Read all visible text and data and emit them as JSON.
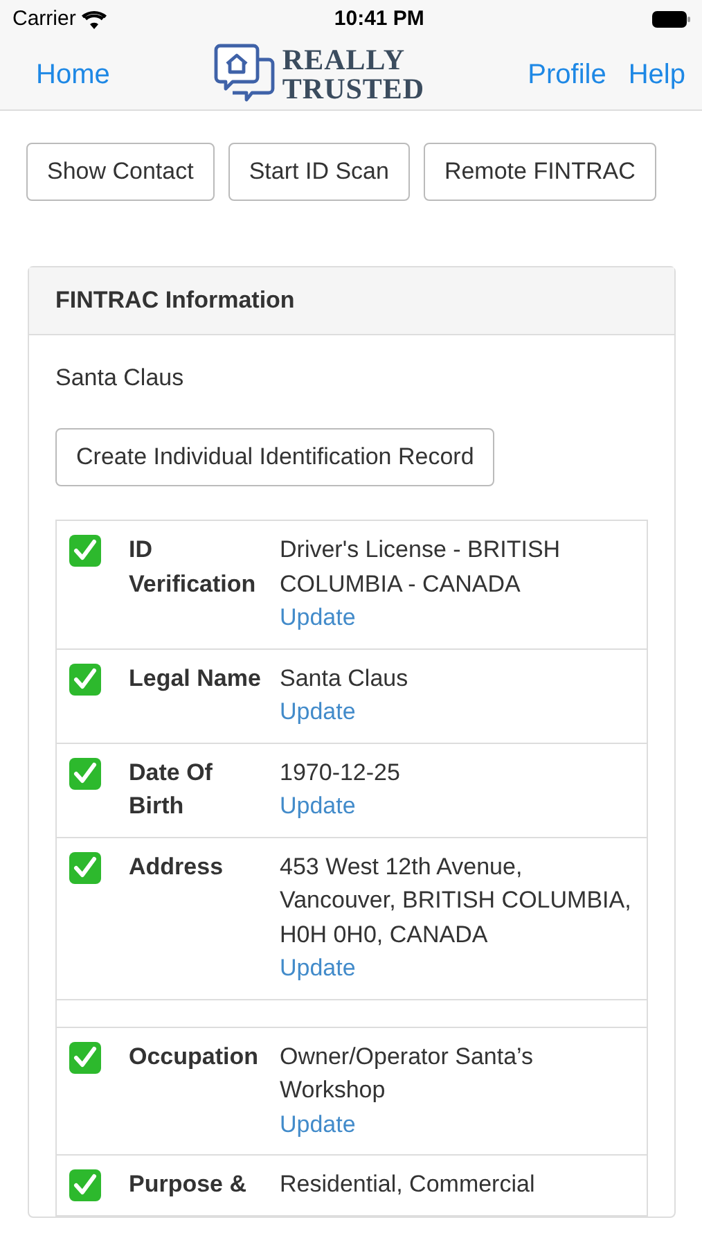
{
  "status_bar": {
    "carrier": "Carrier",
    "time": "10:41 PM"
  },
  "nav": {
    "left": "Home",
    "logo": [
      "REALLY",
      "TRUSTED"
    ],
    "right": [
      "Profile",
      "Help"
    ]
  },
  "actions": [
    "Show Contact",
    "Start ID Scan",
    "Remote FINTRAC"
  ],
  "card": {
    "title": "FINTRAC Information",
    "client": "Santa Claus",
    "create_button": "Create Individual Identification Record",
    "rows": [
      {
        "kind": "item",
        "checked": true,
        "label": "ID Verification",
        "value": "Driver's License - BRITISH COLUMBIA - CANADA",
        "link": "Update"
      },
      {
        "kind": "item",
        "checked": true,
        "label": "Legal Name",
        "value": "Santa Claus",
        "link": "Update"
      },
      {
        "kind": "item",
        "checked": true,
        "label": "Date Of Birth",
        "value": "1970-12-25",
        "link": "Update"
      },
      {
        "kind": "item",
        "checked": true,
        "label": "Address",
        "value": "453 West 12th Avenue, Vancouver, BRITISH COLUMBIA, H0H 0H0, CANADA",
        "link": "Update"
      },
      {
        "kind": "spacer"
      },
      {
        "kind": "item",
        "checked": true,
        "label": "Occupation",
        "value": "Owner/Operator Santa’s Workshop",
        "link": "Update"
      },
      {
        "kind": "item",
        "checked": true,
        "label": "Purpose &",
        "value": "Residential, Commercial"
      }
    ]
  }
}
